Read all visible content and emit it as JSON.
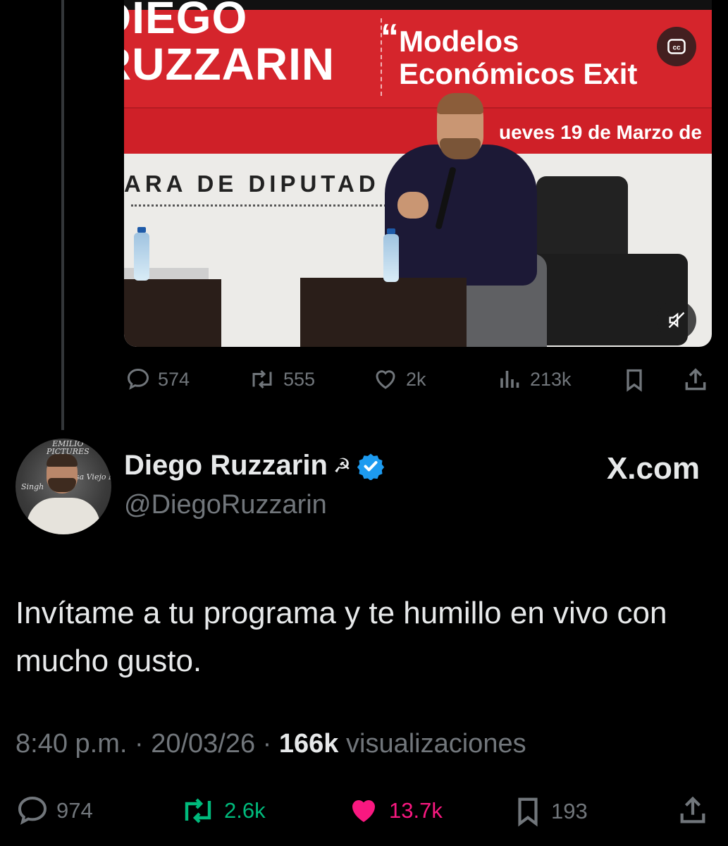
{
  "video": {
    "banner_left": "DIEGO\nRUZZARIN",
    "banner_title_line1": "Modelos",
    "banner_title_line2": "Económicos Exit",
    "banner_quote": "“",
    "banner_date": "ueves 19 de Marzo de",
    "banner_venue": "ARA DE DIPUTAD",
    "cc_label": "cc"
  },
  "quoted_actions": {
    "replies": "574",
    "reposts": "555",
    "likes": "2k",
    "views": "213k"
  },
  "tweet": {
    "display_name": "Diego Ruzzarin",
    "name_emoji": "☭",
    "handle": "@DiegoRuzzarin",
    "source": "X.com",
    "text": "Invítame a tu programa y te humillo en vivo con mucho gusto.",
    "time": "8:40 p.m.",
    "sep1": " · ",
    "date": "20/03/26",
    "sep2": " · ",
    "views_count": "166k",
    "views_label": " visualizaciones",
    "avatar_text_top": "EMILIO\nPICTURES",
    "avatar_text_left": "Singh",
    "avatar_text_mid": "Casa Viejo  MA"
  },
  "actions": {
    "replies": "974",
    "reposts": "2.6k",
    "likes": "13.7k",
    "bookmarks": "193"
  },
  "colors": {
    "background": "#000000",
    "text": "#e7e9ea",
    "muted": "#71767b",
    "repost_active": "#00ba7c",
    "like_active": "#f91880",
    "verified": "#1d9bf0",
    "banner_red": "#d5252c"
  }
}
